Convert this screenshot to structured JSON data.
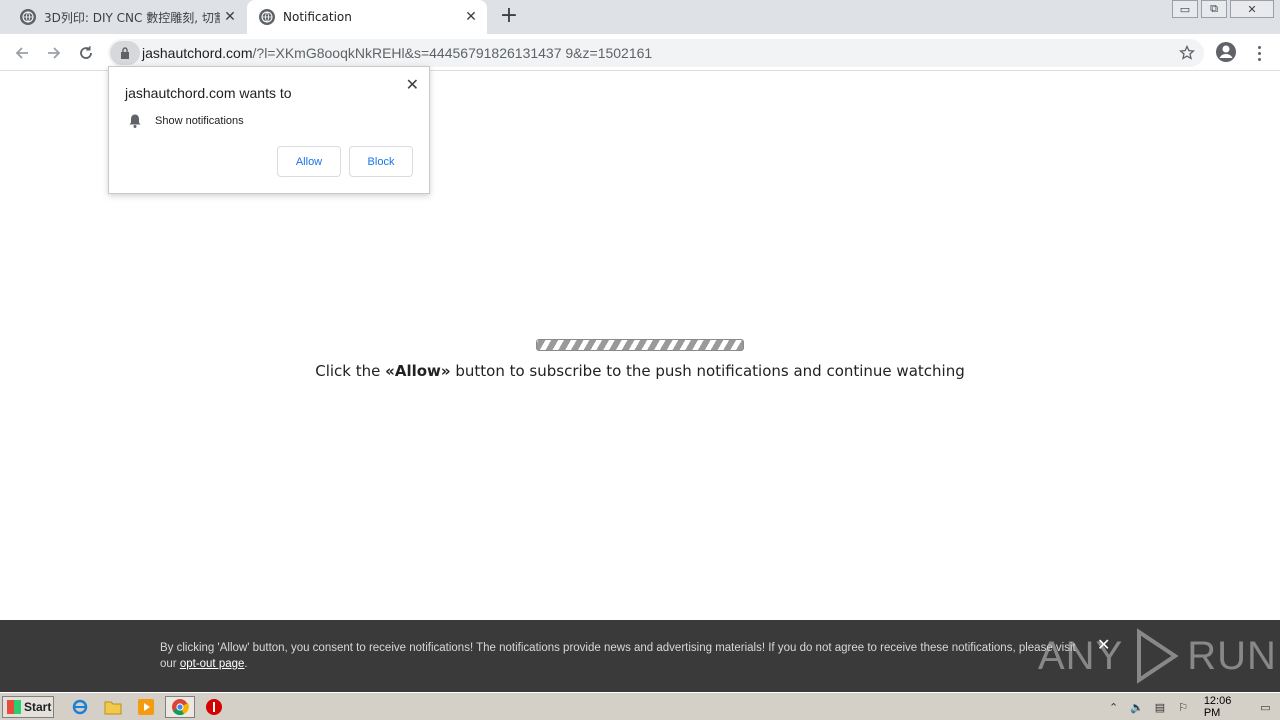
{
  "browser": {
    "tabs": [
      {
        "title": "3D列印: DIY CNC 數控雕刻, 切割, 紙",
        "active": false
      },
      {
        "title": "Notification",
        "active": true
      }
    ],
    "new_tab_symbol": "+",
    "tab_close_symbol": "✕",
    "window_controls": {
      "minimize": "▭",
      "restore": "⧉",
      "close": "✕"
    },
    "address": {
      "host": "jashautchord.com",
      "path": "/?l=XKmG8ooqkNkREHl&s=44456791826131437 9&z=1502161"
    }
  },
  "permission_prompt": {
    "heading": "jashautchord.com wants to",
    "permission": "Show notifications",
    "allow_label": "Allow",
    "block_label": "Block",
    "close_symbol": "✕"
  },
  "page": {
    "progress_label": "",
    "cta_prefix": "Click the ",
    "cta_bold": "«Allow»",
    "cta_suffix": " button to subscribe to the push notifications and continue watching"
  },
  "consent_bar": {
    "message": "By clicking 'Allow' button, you consent to receive notifications! The notifications provide news and advertising materials! If you do not agree to receive these notifications, please visit our ",
    "link_text": "opt-out page",
    "message_end": ".",
    "close_symbol": "✕",
    "watermark_left": "ANY",
    "watermark_right": "RUN"
  },
  "taskbar": {
    "start_label": "Start",
    "clock": "12:06 PM"
  },
  "colors": {
    "tabstrip": "#dee1e6",
    "accent_blue": "#1a73e8",
    "consent_bg": "#3a3a3a",
    "taskbar": "#d4d0c8"
  }
}
